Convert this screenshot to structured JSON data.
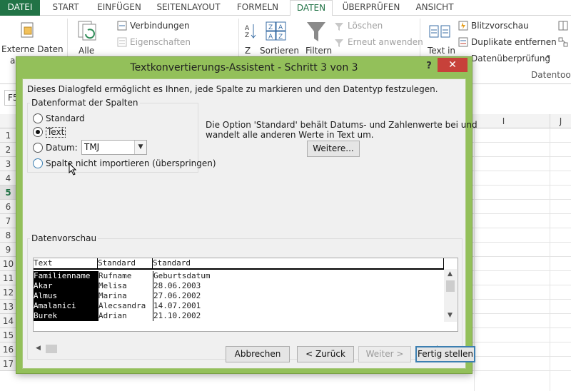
{
  "ribbon_tabs": [
    "DATEI",
    "START",
    "EINFÜGEN",
    "SEITENLAYOUT",
    "FORMELN",
    "DATEN",
    "ÜBERPRÜFEN",
    "ANSICHT"
  ],
  "ribbon": {
    "externe_daten": "Externe Daten",
    "externe_daten_2": "ab",
    "alle": "Alle",
    "verbindungen": "Verbindungen",
    "eigenschaften": "Eigenschaften",
    "sortieren": "Sortieren",
    "filtern": "Filtern",
    "loeschen": "Löschen",
    "erneut_anwenden": "Erneut anwenden",
    "text_in": "Text in",
    "blitzvorschau": "Blitzvorschau",
    "duplikate": "Duplikate entfernen",
    "datenueberpruefung": "Datenüberprüfung",
    "datentools": "Datentools"
  },
  "namebox": "F5",
  "columns": [
    "I",
    "J"
  ],
  "rows": [
    "1",
    "2",
    "3",
    "4",
    "5",
    "6",
    "7",
    "8",
    "9",
    "10",
    "11",
    "12",
    "13",
    "14",
    "15",
    "16",
    "17"
  ],
  "selected_row": "5",
  "dialog": {
    "title": "Textkonvertierungs-Assistent - Schritt 3 von 3",
    "help": "?",
    "close": "✕",
    "intro": "Dieses Dialogfeld ermöglicht es Ihnen, jede Spalte zu markieren und den Datentyp festzulegen.",
    "group_label": "Datenformat der Spalten",
    "radio_standard": "Standard",
    "radio_text": "Text",
    "radio_datum": "Datum:",
    "datum_value": "TMJ",
    "radio_skip": "Spalte nicht importieren (überspringen)",
    "info_line1": "Die Option 'Standard' behält Datums- und Zahlenwerte bei und",
    "info_line2": "wandelt alle anderen Werte in Text um.",
    "weitere": "Weitere...",
    "preview_label": "Datenvorschau",
    "preview_headers": [
      "Text",
      "Standard",
      "Standard"
    ],
    "preview_rows": [
      [
        "Familienname",
        "Rufname",
        "Geburtsdatum"
      ],
      [
        "Akar",
        "Melisa",
        "28.06.2003"
      ],
      [
        "Almus",
        "Marina",
        "27.06.2002"
      ],
      [
        "Amalanici",
        "Alecsandra",
        "14.07.2001"
      ],
      [
        "Burek",
        "Adrian",
        "21.10.2002"
      ]
    ],
    "btn_cancel": "Abbrechen",
    "btn_back": "< Zurück",
    "btn_next": "Weiter >",
    "btn_finish": "Fertig stellen"
  }
}
